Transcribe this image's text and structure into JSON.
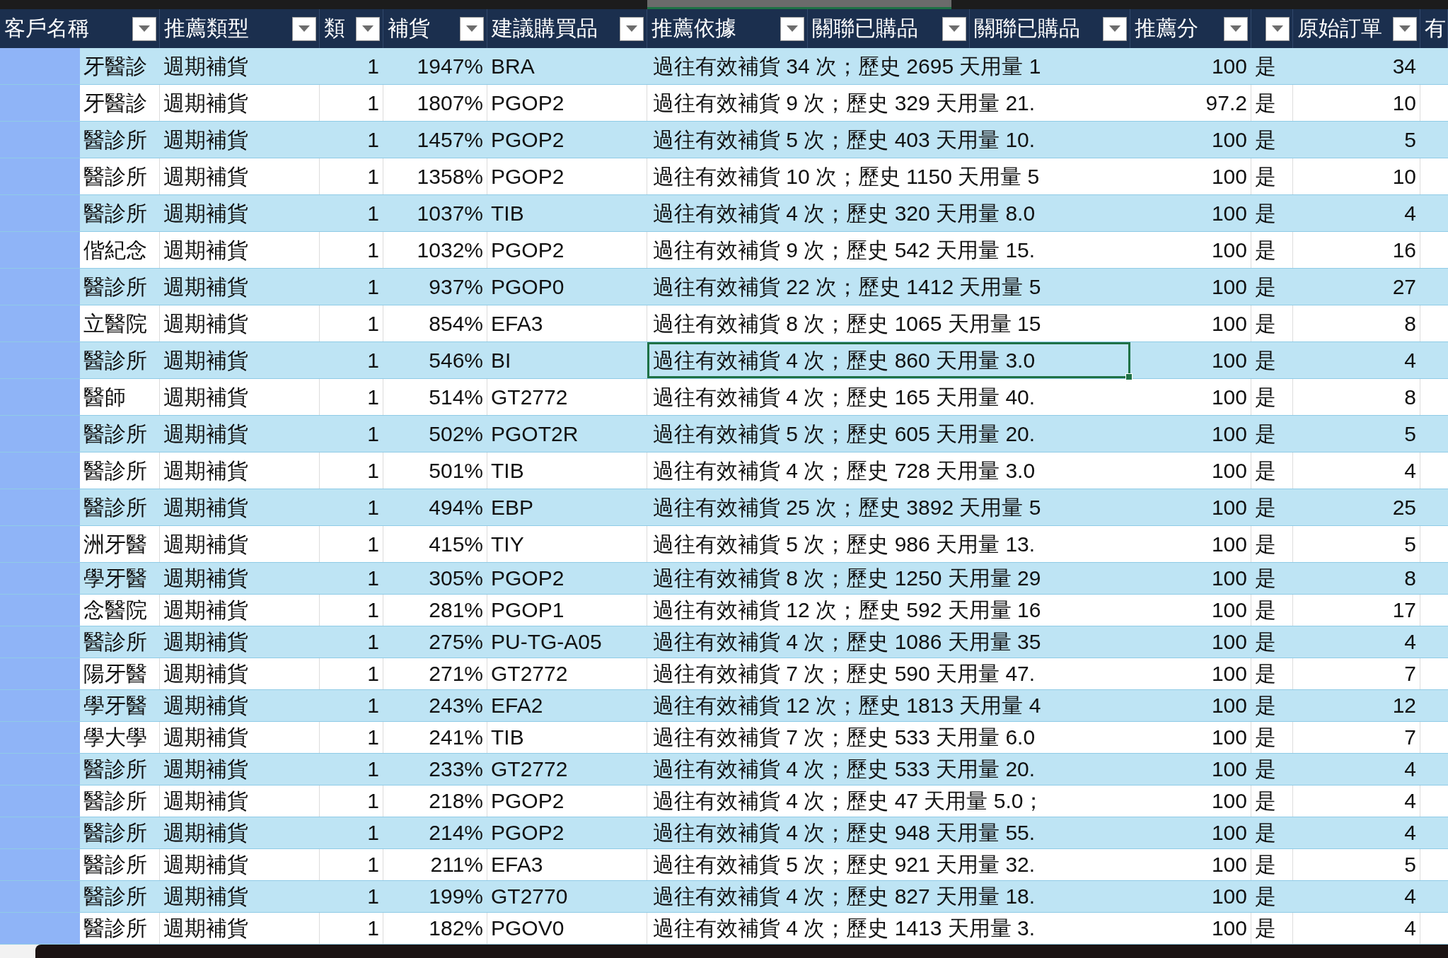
{
  "table": {
    "columns": [
      {
        "label": "客戶名稱"
      },
      {
        "label": "推薦類型"
      },
      {
        "label": "類"
      },
      {
        "label": "補貨"
      },
      {
        "label": "建議購買品"
      },
      {
        "label": "推薦依據"
      },
      {
        "label": "關聯已購品"
      },
      {
        "label": "關聯已購品"
      },
      {
        "label": "推薦分"
      },
      {},
      {
        "label": "原始訂單"
      },
      {
        "label": "有"
      }
    ],
    "rows": [
      {
        "customer": "牙醫診",
        "type": "週期補貨",
        "category": "1",
        "ratio": "1947%",
        "product": "BRA",
        "basis": "過往有效補貨 34 次；歷史 2695 天用量 1",
        "score": "100",
        "flag": "是",
        "orders": "34",
        "selected": false
      },
      {
        "customer": "牙醫診",
        "type": "週期補貨",
        "category": "1",
        "ratio": "1807%",
        "product": "PGOP2",
        "basis": "過往有效補貨 9 次；歷史 329 天用量 21.",
        "score": "97.2",
        "flag": "是",
        "orders": "10",
        "selected": false
      },
      {
        "customer": "醫診所",
        "type": "週期補貨",
        "category": "1",
        "ratio": "1457%",
        "product": "PGOP2",
        "basis": "過往有效補貨 5 次；歷史 403 天用量 10.",
        "score": "100",
        "flag": "是",
        "orders": "5",
        "selected": false
      },
      {
        "customer": "醫診所",
        "type": "週期補貨",
        "category": "1",
        "ratio": "1358%",
        "product": "PGOP2",
        "basis": "過往有效補貨 10 次；歷史 1150 天用量 5",
        "score": "100",
        "flag": "是",
        "orders": "10",
        "selected": false
      },
      {
        "customer": "醫診所",
        "type": "週期補貨",
        "category": "1",
        "ratio": "1037%",
        "product": "TIB",
        "basis": "過往有效補貨 4 次；歷史 320 天用量 8.0",
        "score": "100",
        "flag": "是",
        "orders": "4",
        "selected": false
      },
      {
        "customer": "偕紀念",
        "type": "週期補貨",
        "category": "1",
        "ratio": "1032%",
        "product": "PGOP2",
        "basis": "過往有效補貨 9 次；歷史 542 天用量 15.",
        "score": "100",
        "flag": "是",
        "orders": "16",
        "selected": false
      },
      {
        "customer": "醫診所",
        "type": "週期補貨",
        "category": "1",
        "ratio": "937%",
        "product": "PGOP0",
        "basis": "過往有效補貨 22 次；歷史 1412 天用量 5",
        "score": "100",
        "flag": "是",
        "orders": "27",
        "selected": false
      },
      {
        "customer": "立醫院",
        "type": "週期補貨",
        "category": "1",
        "ratio": "854%",
        "product": "EFA3",
        "basis": "過往有效補貨 8 次；歷史 1065 天用量 15",
        "score": "100",
        "flag": "是",
        "orders": "8",
        "selected": false
      },
      {
        "customer": "醫診所",
        "type": "週期補貨",
        "category": "1",
        "ratio": "546%",
        "product": "BI",
        "basis": "過往有效補貨 4 次；歷史 860 天用量 3.0",
        "score": "100",
        "flag": "是",
        "orders": "4",
        "selected": true
      },
      {
        "customer": "醫師",
        "type": "週期補貨",
        "category": "1",
        "ratio": "514%",
        "product": "GT2772",
        "basis": "過往有效補貨 4 次；歷史 165 天用量 40.",
        "score": "100",
        "flag": "是",
        "orders": "8",
        "selected": false
      },
      {
        "customer": "醫診所",
        "type": "週期補貨",
        "category": "1",
        "ratio": "502%",
        "product": "PGOT2R",
        "basis": "過往有效補貨 5 次；歷史 605 天用量 20.",
        "score": "100",
        "flag": "是",
        "orders": "5",
        "selected": false
      },
      {
        "customer": "醫診所",
        "type": "週期補貨",
        "category": "1",
        "ratio": "501%",
        "product": "TIB",
        "basis": "過往有效補貨 4 次；歷史 728 天用量 3.0",
        "score": "100",
        "flag": "是",
        "orders": "4",
        "selected": false
      },
      {
        "customer": "醫診所",
        "type": "週期補貨",
        "category": "1",
        "ratio": "494%",
        "product": "EBP",
        "basis": "過往有效補貨 25 次；歷史 3892 天用量 5",
        "score": "100",
        "flag": "是",
        "orders": "25",
        "selected": false
      },
      {
        "customer": "洲牙醫",
        "type": "週期補貨",
        "category": "1",
        "ratio": "415%",
        "product": "TIY",
        "basis": "過往有效補貨 5 次；歷史 986 天用量 13.",
        "score": "100",
        "flag": "是",
        "orders": "5",
        "selected": false
      },
      {
        "customer": "學牙醫",
        "type": "週期補貨",
        "category": "1",
        "ratio": "305%",
        "product": "PGOP2",
        "basis": "過往有效補貨 8 次；歷史 1250 天用量 29",
        "score": "100",
        "flag": "是",
        "orders": "8",
        "selected": false
      },
      {
        "customer": "念醫院",
        "type": "週期補貨",
        "category": "1",
        "ratio": "281%",
        "product": "PGOP1",
        "basis": "過往有效補貨 12 次；歷史 592 天用量 16",
        "score": "100",
        "flag": "是",
        "orders": "17",
        "selected": false
      },
      {
        "customer": "醫診所",
        "type": "週期補貨",
        "category": "1",
        "ratio": "275%",
        "product": "PU-TG-A05",
        "basis": "過往有效補貨 4 次；歷史 1086 天用量 35",
        "score": "100",
        "flag": "是",
        "orders": "4",
        "selected": false
      },
      {
        "customer": "陽牙醫",
        "type": "週期補貨",
        "category": "1",
        "ratio": "271%",
        "product": "GT2772",
        "basis": "過往有效補貨 7 次；歷史 590 天用量 47.",
        "score": "100",
        "flag": "是",
        "orders": "7",
        "selected": false
      },
      {
        "customer": "學牙醫",
        "type": "週期補貨",
        "category": "1",
        "ratio": "243%",
        "product": "EFA2",
        "basis": "過往有效補貨 12 次；歷史 1813 天用量 4",
        "score": "100",
        "flag": "是",
        "orders": "12",
        "selected": false
      },
      {
        "customer": "學大學",
        "type": "週期補貨",
        "category": "1",
        "ratio": "241%",
        "product": "TIB",
        "basis": "過往有效補貨 7 次；歷史 533 天用量 6.0",
        "score": "100",
        "flag": "是",
        "orders": "7",
        "selected": false
      },
      {
        "customer": "醫診所",
        "type": "週期補貨",
        "category": "1",
        "ratio": "233%",
        "product": "GT2772",
        "basis": "過往有效補貨 4 次；歷史 533 天用量 20.",
        "score": "100",
        "flag": "是",
        "orders": "4",
        "selected": false
      },
      {
        "customer": "醫診所",
        "type": "週期補貨",
        "category": "1",
        "ratio": "218%",
        "product": "PGOP2",
        "basis": "過往有效補貨 4 次；歷史 47 天用量 5.0；",
        "score": "100",
        "flag": "是",
        "orders": "4",
        "selected": false
      },
      {
        "customer": "醫診所",
        "type": "週期補貨",
        "category": "1",
        "ratio": "214%",
        "product": "PGOP2",
        "basis": "過往有效補貨 4 次；歷史 948 天用量 55.",
        "score": "100",
        "flag": "是",
        "orders": "4",
        "selected": false
      },
      {
        "customer": "醫診所",
        "type": "週期補貨",
        "category": "1",
        "ratio": "211%",
        "product": "EFA3",
        "basis": "過往有效補貨 5 次；歷史 921 天用量 32.",
        "score": "100",
        "flag": "是",
        "orders": "5",
        "selected": false
      },
      {
        "customer": "醫診所",
        "type": "週期補貨",
        "category": "1",
        "ratio": "199%",
        "product": "GT2770",
        "basis": "過往有效補貨 4 次；歷史 827 天用量 18.",
        "score": "100",
        "flag": "是",
        "orders": "4",
        "selected": false
      },
      {
        "customer": "醫診所",
        "type": "週期補貨",
        "category": "1",
        "ratio": "182%",
        "product": "PGOV0",
        "basis": "過往有效補貨 4 次；歷史 1413 天用量 3.",
        "score": "100",
        "flag": "是",
        "orders": "4",
        "selected": false
      }
    ]
  }
}
